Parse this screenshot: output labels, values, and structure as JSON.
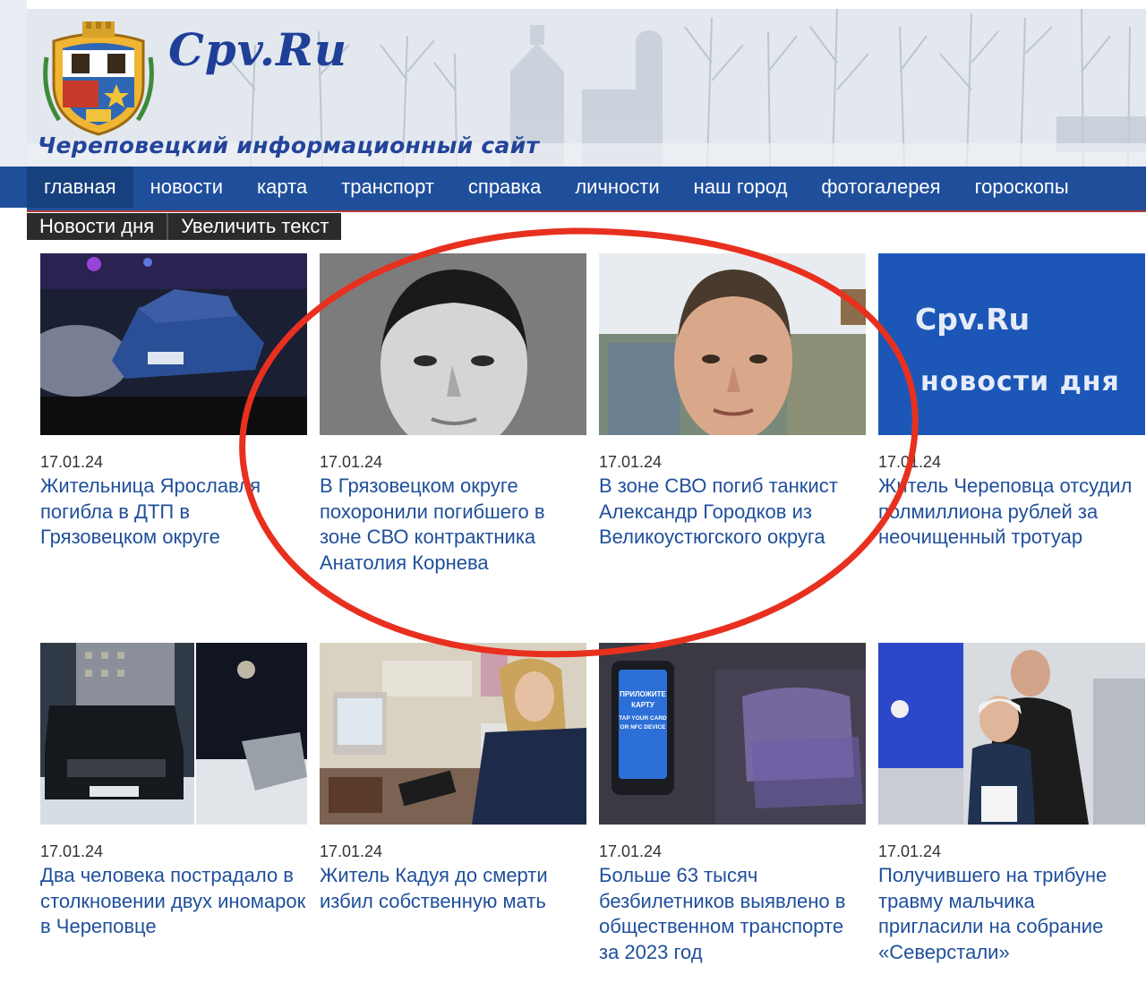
{
  "header": {
    "site_title": "Cpv.Ru",
    "site_subtitle": "Череповецкий информационный сайт"
  },
  "nav": {
    "items": [
      {
        "label": "главная",
        "active": true
      },
      {
        "label": "новости"
      },
      {
        "label": "карта"
      },
      {
        "label": "транспорт"
      },
      {
        "label": "справка"
      },
      {
        "label": "личности"
      },
      {
        "label": "наш город"
      },
      {
        "label": "фотогалерея"
      },
      {
        "label": "гороскопы"
      }
    ]
  },
  "subbar": {
    "news_of_day": "Новости дня",
    "enlarge_text": "Увеличить текст"
  },
  "promo_tile": {
    "line1": "Cpv.Ru",
    "line2": "новости дня"
  },
  "news": [
    {
      "date": "17.01.24",
      "title": "Жительница Ярославля погибла в ДТП в Грязовецком округе"
    },
    {
      "date": "17.01.24",
      "title": "В Грязовецком округе похоронили погибшего в зоне СВО контрактника Анатолия Корнева"
    },
    {
      "date": "17.01.24",
      "title": "В зоне СВО погиб танкист Александр Городков из Великоустюгского округа"
    },
    {
      "date": "17.01.24",
      "title": "Житель Череповца отсудил полмиллиона рублей за неочищенный тротуар"
    },
    {
      "date": "17.01.24",
      "title": "Два человека пострадало в столкновении двух иномарок в Череповце"
    },
    {
      "date": "17.01.24",
      "title": "Житель Кадуя до смерти избил собственную мать"
    },
    {
      "date": "17.01.24",
      "title": "Больше 63 тысяч безбилетников выявлено в общественном транспорте за 2023 год"
    },
    {
      "date": "17.01.24",
      "title": "Получившего на трибуне травму мальчика пригласили на собрание «Северстали»"
    }
  ],
  "validator_text": {
    "l1": "ПРИЛОЖИТЕ",
    "l2": "КАРТУ",
    "l3": "TAP YOUR CARD",
    "l4": "OR NFC DEVICE"
  },
  "colors": {
    "nav_bg": "#1f4f9b",
    "link": "#1f4f9b",
    "annotation": "#e8301f"
  }
}
